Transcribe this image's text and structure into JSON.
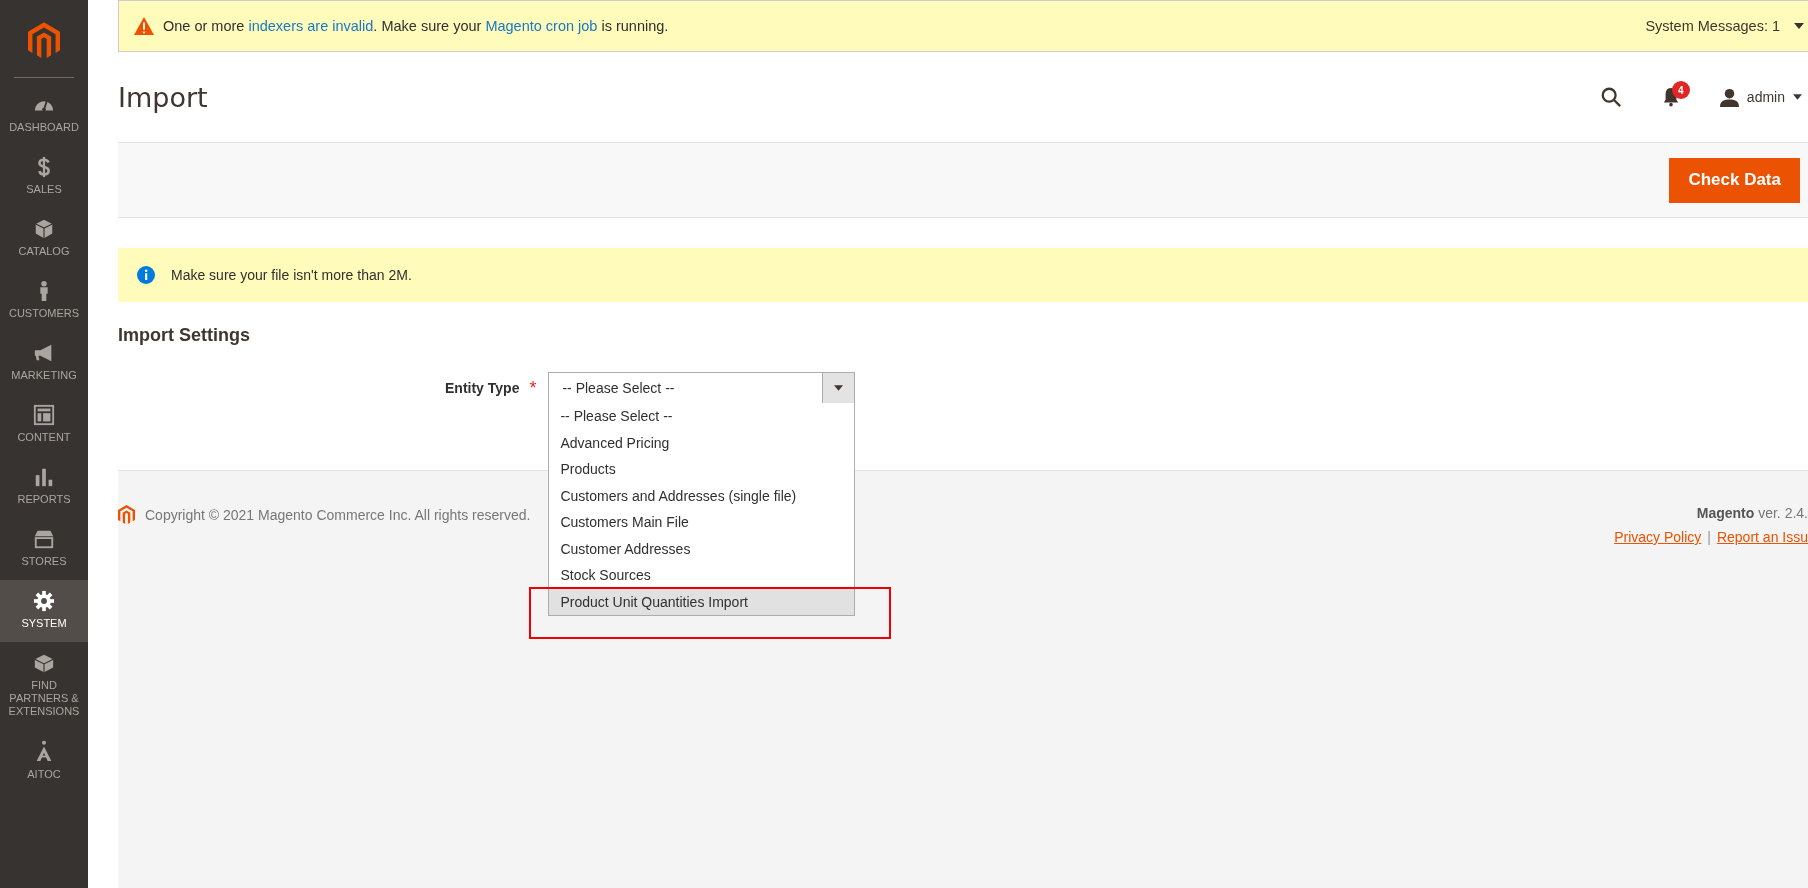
{
  "sidebar": {
    "items": [
      {
        "label": "DASHBOARD",
        "selected": false
      },
      {
        "label": "SALES",
        "selected": false
      },
      {
        "label": "CATALOG",
        "selected": false
      },
      {
        "label": "CUSTOMERS",
        "selected": false
      },
      {
        "label": "MARKETING",
        "selected": false
      },
      {
        "label": "CONTENT",
        "selected": false
      },
      {
        "label": "REPORTS",
        "selected": false
      },
      {
        "label": "STORES",
        "selected": false
      },
      {
        "label": "SYSTEM",
        "selected": true
      },
      {
        "label": "FIND PARTNERS & EXTENSIONS",
        "selected": false
      },
      {
        "label": "AITOC",
        "selected": false
      }
    ]
  },
  "system_message": {
    "parts": [
      {
        "text": "One or more ",
        "link": false
      },
      {
        "text": "indexers are invalid",
        "link": true
      },
      {
        "text": ". Make sure your ",
        "link": false
      },
      {
        "text": "Magento cron job",
        "link": true
      },
      {
        "text": " is running.",
        "link": false
      }
    ],
    "counter": "System Messages: 1"
  },
  "header": {
    "title": "Import",
    "notifications_count": "4",
    "user": "admin"
  },
  "actions": {
    "primary_button": "Check Data"
  },
  "notice": "Make sure your file isn't more than 2M.",
  "form": {
    "section_title": "Import Settings",
    "field_label": "Entity Type",
    "required_mark": "*",
    "select_value": "-- Please Select --",
    "options": [
      {
        "label": "-- Please Select --",
        "selected": false
      },
      {
        "label": "Advanced Pricing",
        "selected": false
      },
      {
        "label": "Products",
        "selected": false
      },
      {
        "label": "Customers and Addresses (single file)",
        "selected": false
      },
      {
        "label": "Customers Main File",
        "selected": false
      },
      {
        "label": "Customer Addresses",
        "selected": false
      },
      {
        "label": "Stock Sources",
        "selected": false
      },
      {
        "label": "Product Unit Quantities Import",
        "selected": true
      }
    ]
  },
  "footer": {
    "copyright": "Copyright © 2021 Magento Commerce Inc. All rights reserved.",
    "version": "**Magento** ver. 2.4.",
    "links": [
      "Privacy Policy",
      "Report an Issu"
    ],
    "separator": "|"
  }
}
